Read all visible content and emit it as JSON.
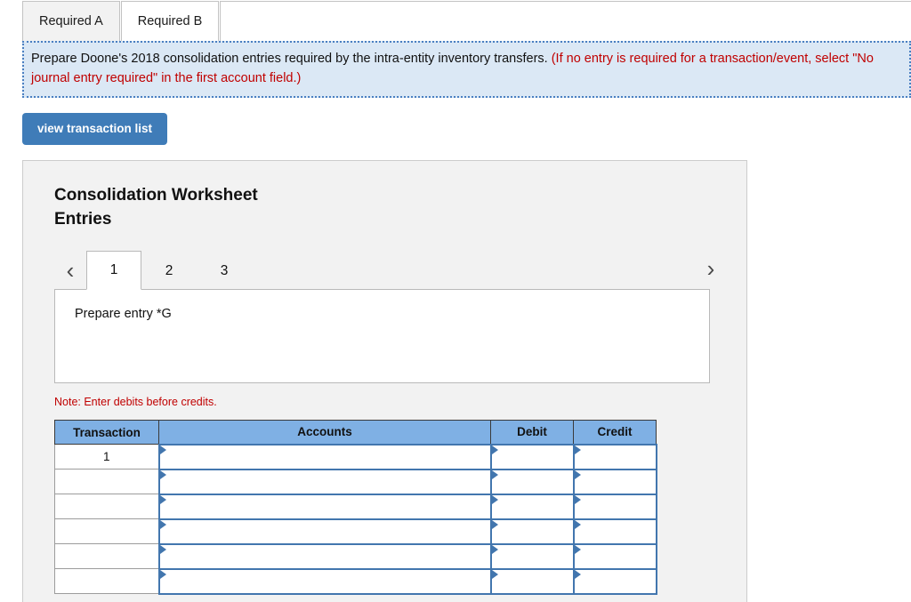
{
  "tabs": [
    {
      "label": "Required A",
      "active": false
    },
    {
      "label": "Required B",
      "active": true
    }
  ],
  "instruction": {
    "main": "Prepare Doone's 2018 consolidation entries required by the intra-entity inventory transfers.",
    "hint": "(If no entry is required for a transaction/event, select \"No journal entry required\" in the first account field.)"
  },
  "toolbar": {
    "view_transaction_list_label": "view transaction list"
  },
  "card": {
    "title": "Consolidation Worksheet Entries",
    "pager": {
      "prev_icon": "chevron-left-icon",
      "next_icon": "chevron-right-icon",
      "pages": [
        {
          "label": "1",
          "active": true
        },
        {
          "label": "2",
          "active": false
        },
        {
          "label": "3",
          "active": false
        }
      ]
    },
    "entry_prompt": "Prepare entry *G",
    "note": "Note: Enter debits before credits."
  },
  "journal": {
    "columns": [
      "Transaction",
      "Accounts",
      "Debit",
      "Credit"
    ],
    "rows": [
      {
        "transaction": "1",
        "accounts": "",
        "debit": "",
        "credit": ""
      },
      {
        "transaction": "",
        "accounts": "",
        "debit": "",
        "credit": ""
      },
      {
        "transaction": "",
        "accounts": "",
        "debit": "",
        "credit": ""
      },
      {
        "transaction": "",
        "accounts": "",
        "debit": "",
        "credit": ""
      },
      {
        "transaction": "",
        "accounts": "",
        "debit": "",
        "credit": ""
      },
      {
        "transaction": "",
        "accounts": "",
        "debit": "",
        "credit": ""
      }
    ]
  },
  "colors": {
    "banner_bg": "#dbe8f5",
    "banner_border": "#4a7fc1",
    "hint_red": "#c00000",
    "button_blue": "#3f7cb8",
    "table_header_blue": "#7fb0e4",
    "input_border_blue": "#4276ae",
    "card_bg": "#f2f2f2"
  }
}
